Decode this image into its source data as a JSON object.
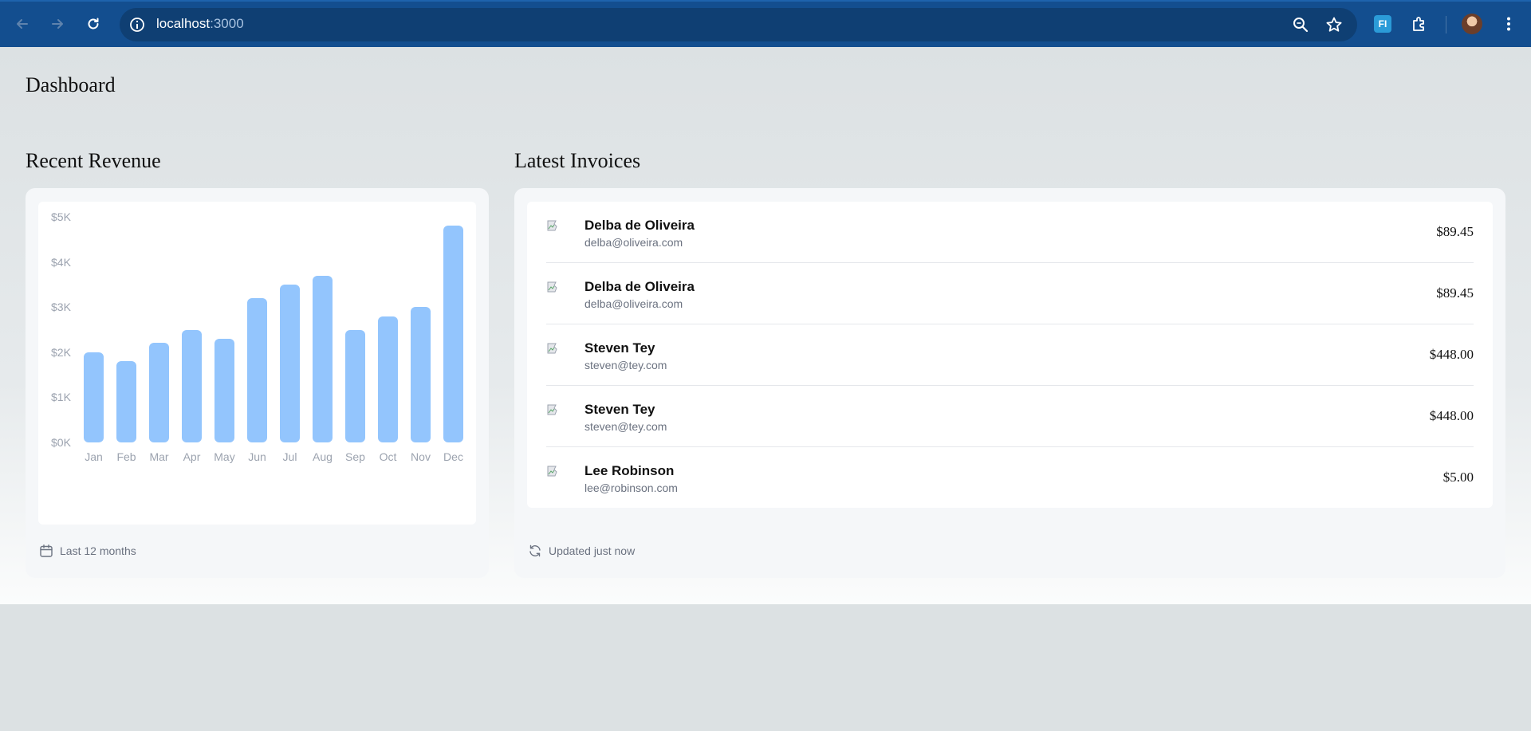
{
  "browser": {
    "url_host": "localhost",
    "url_port": ":3000",
    "extension_badge": "FI"
  },
  "page": {
    "title": "Dashboard"
  },
  "revenue": {
    "title": "Recent Revenue",
    "footer": "Last 12 months",
    "chart_data": {
      "type": "bar",
      "categories": [
        "Jan",
        "Feb",
        "Mar",
        "Apr",
        "May",
        "Jun",
        "Jul",
        "Aug",
        "Sep",
        "Oct",
        "Nov",
        "Dec"
      ],
      "values": [
        2000,
        1800,
        2200,
        2500,
        2300,
        3200,
        3500,
        3700,
        2500,
        2800,
        3000,
        4800
      ],
      "ytick_labels": [
        "$5K",
        "$4K",
        "$3K",
        "$2K",
        "$1K",
        "$0K"
      ],
      "ylim": [
        0,
        5000
      ]
    }
  },
  "invoices": {
    "title": "Latest Invoices",
    "footer": "Updated just now",
    "items": [
      {
        "name": "Delba de Oliveira",
        "email": "delba@oliveira.com",
        "amount": "$89.45"
      },
      {
        "name": "Delba de Oliveira",
        "email": "delba@oliveira.com",
        "amount": "$89.45"
      },
      {
        "name": "Steven Tey",
        "email": "steven@tey.com",
        "amount": "$448.00"
      },
      {
        "name": "Steven Tey",
        "email": "steven@tey.com",
        "amount": "$448.00"
      },
      {
        "name": "Lee Robinson",
        "email": "lee@robinson.com",
        "amount": "$5.00"
      }
    ]
  }
}
